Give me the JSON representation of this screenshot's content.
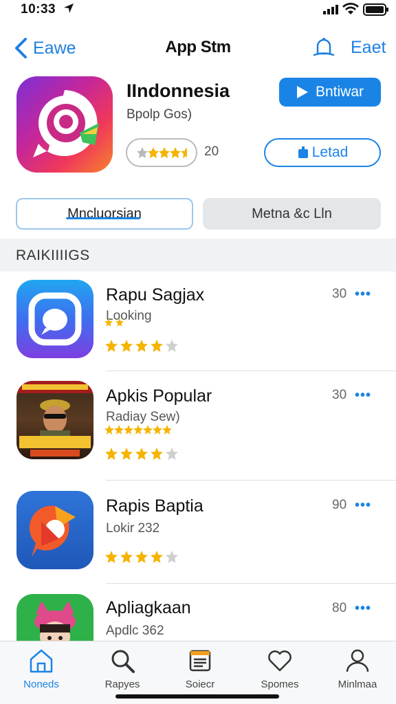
{
  "status": {
    "time": "10:33"
  },
  "nav": {
    "back_label": "Eawe",
    "title": "App Stm",
    "edit_label": "Eaet"
  },
  "hero": {
    "name": "IIndonnesia",
    "subtitle": "Bpolp Gos)",
    "rating_stars": 4,
    "count": "20",
    "play_label": "Bntiwar",
    "load_label": "Letad"
  },
  "segments": {
    "left": "Mncluorsian",
    "right": "Metna &c Lln"
  },
  "section": {
    "title": "RAIKIIIIGS"
  },
  "rows": [
    {
      "title": "Rapu Sagjax",
      "subtitle": "Looking",
      "count": "30",
      "rating": 4,
      "more": "•••"
    },
    {
      "title": "Apkis Popular",
      "subtitle": "Radiay Sew)",
      "count": "30",
      "rating": 4,
      "more": "•••"
    },
    {
      "title": "Rapis Baptia",
      "subtitle": "Lokir 232",
      "count": "90",
      "rating": 4,
      "more": "•••"
    },
    {
      "title": "Apliagkaan",
      "subtitle": "Apdlc 362",
      "count": "80",
      "rating": 4,
      "more": "•••"
    }
  ],
  "tabs": [
    {
      "label": "Noneds"
    },
    {
      "label": "Rapyes"
    },
    {
      "label": "Soiecr"
    },
    {
      "label": "Spomes"
    },
    {
      "label": "Minlmaa"
    }
  ],
  "colors": {
    "accent": "#1a84e6",
    "star": "#f4b400"
  }
}
